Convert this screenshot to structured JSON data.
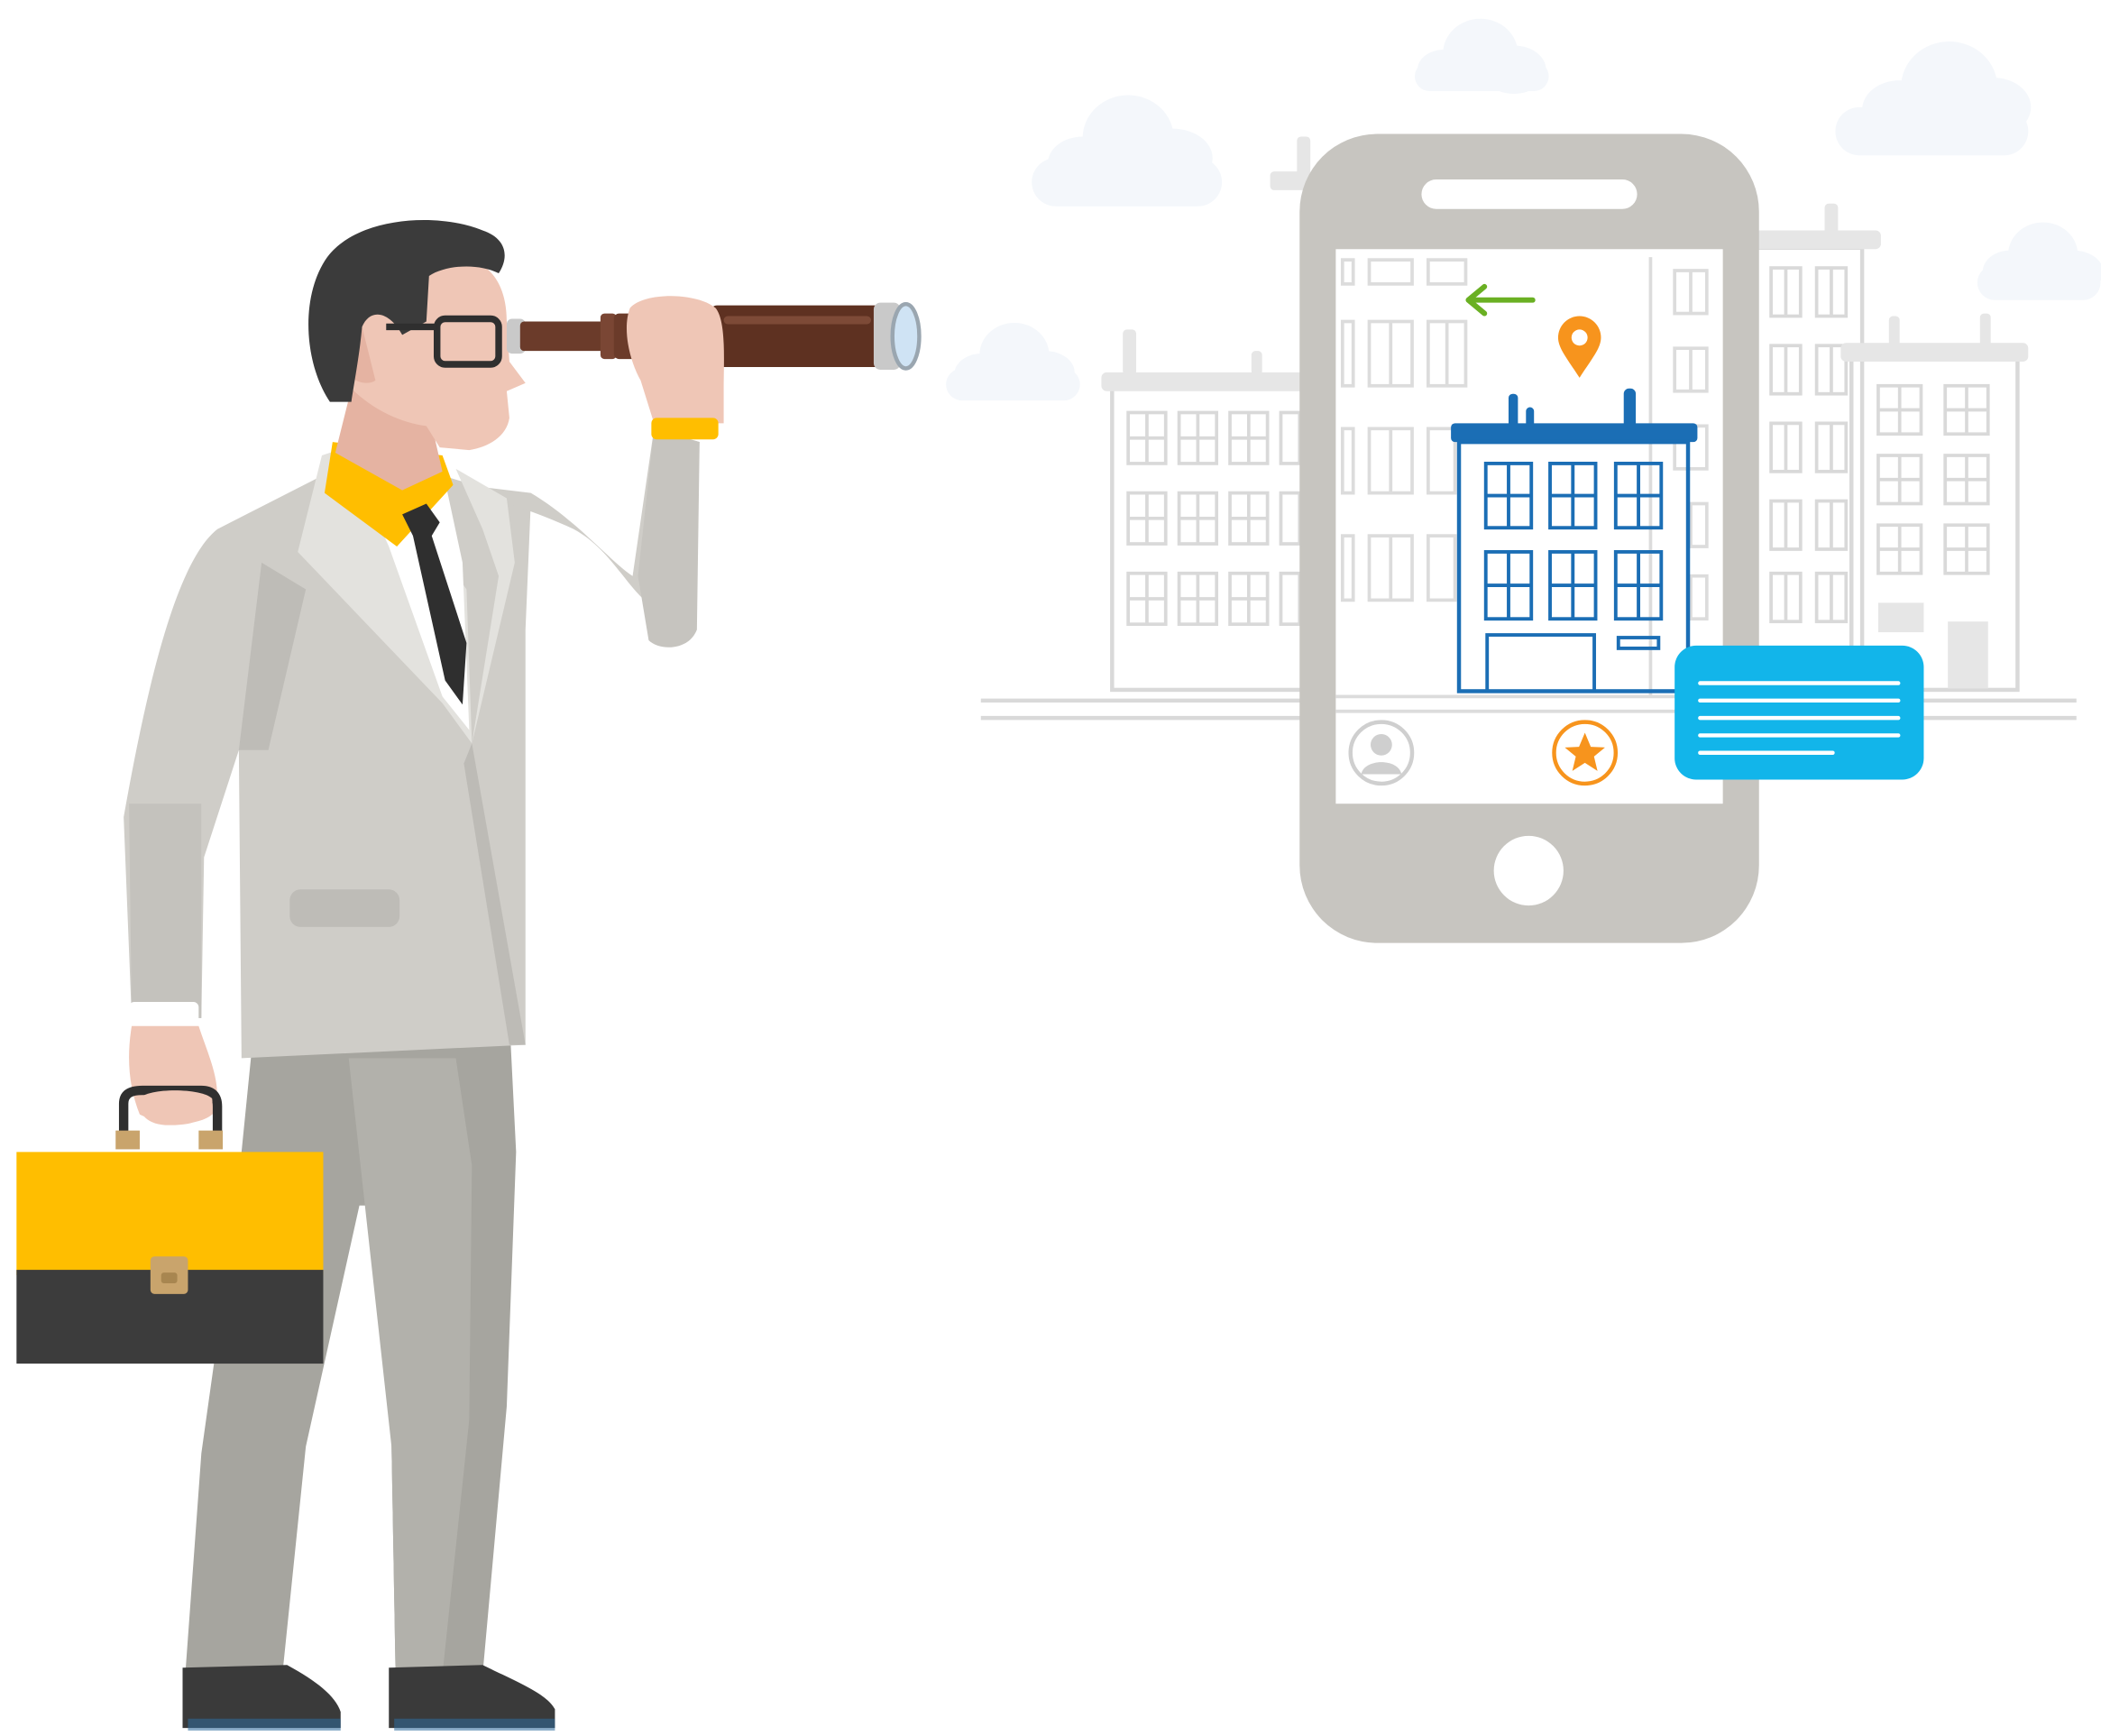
{
  "colors": {
    "background": "#ffffff",
    "cloud": "#f4f7fb",
    "building_outline": "#d9d9d9",
    "phone_body": "#c7c5c0",
    "phone_screen": "#ffffff",
    "accent_yellow": "#ffbe00",
    "suit_light": "#cfcdc8",
    "suit_dark": "#a6a59f",
    "map_pin": "#f7941d",
    "back_arrow": "#6ab023",
    "focus_building": "#1b6eb5",
    "message_bubble": "#12b5ea",
    "telescope": "#6b3b2a"
  },
  "scene": {
    "character": {
      "icon": "businessman-with-telescope",
      "accessories": [
        "telescope-icon",
        "glasses-icon",
        "briefcase-icon"
      ]
    },
    "phone": {
      "icon": "smartphone",
      "screen_content": [
        "back-arrow-icon",
        "map-pin-icon",
        "building-icon"
      ],
      "bottom_bar": [
        "profile-avatar-icon",
        "favorite-star-icon"
      ],
      "overlay": "message-bubble-icon"
    },
    "background": [
      "city-buildings",
      "clouds"
    ]
  }
}
